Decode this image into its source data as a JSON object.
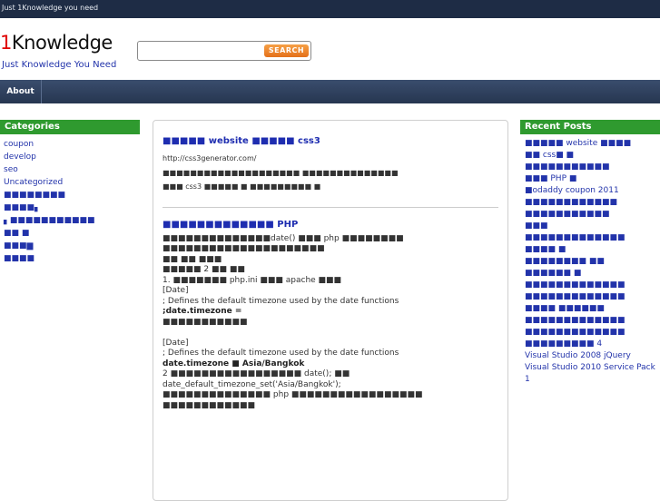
{
  "topbar": {
    "tagline": "Just 1Knowledge you need"
  },
  "header": {
    "logo_prefix": "1",
    "logo_rest": "Knowledge",
    "slogan": "Just Knowledge You Need"
  },
  "search": {
    "placeholder": "",
    "button_label": "SEARCH"
  },
  "nav": {
    "items": [
      {
        "label": "About"
      }
    ]
  },
  "categories": {
    "heading": "Categories",
    "items": [
      {
        "label": "coupon"
      },
      {
        "label": "develop"
      },
      {
        "label": "seo"
      },
      {
        "label": "Uncategorized"
      },
      {
        "label": "■■■■■■■■"
      },
      {
        "label": "■■■■▖"
      },
      {
        "label": "▖■■■■■■■■■■■"
      },
      {
        "label": "■■    ■"
      },
      {
        "label": "■■■▆"
      },
      {
        "label": "■■■■"
      }
    ]
  },
  "recent_posts": {
    "heading": "Recent Posts",
    "items": [
      {
        "label": "■■■■■ website ■■■■"
      },
      {
        "label": "■■ css■    ■"
      },
      {
        "label": "■■■■■■■■■■■"
      },
      {
        "label": "■■■ PHP ■"
      },
      {
        "label": "■odaddy coupon 2011"
      },
      {
        "label": "■■■■■■■■■■■■"
      },
      {
        "label": "■■■■■■■■■■■"
      },
      {
        "label": "■■■"
      },
      {
        "label": "■■■■■■■■■■■■■"
      },
      {
        "label": "■■■■    ■"
      },
      {
        "label": "■■■■■■■■   ■■"
      },
      {
        "label": "■■■■■■    ■"
      },
      {
        "label": "■■■■■■■■■■■■■"
      },
      {
        "label": "■■■■■■■■■■■■■"
      },
      {
        "label": "■■■■    ■■■■■■"
      },
      {
        "label": "■■■■■■■■■■■■■"
      },
      {
        "label": "■■■■■■■■■■■■■"
      },
      {
        "label": "■■■■■■■■■ 4"
      },
      {
        "label": "Visual Studio 2008 jQuery"
      },
      {
        "label": "Visual Studio 2010 Service Pack 1"
      }
    ]
  },
  "posts": [
    {
      "title": "■■■■■ website ■■■■■ css3",
      "url": "http://css3generator.com/",
      "lines": [
        "■■■■■■■■■■■■■■■■■■■■ ■■■■■■■■■■■■■■",
        "■■■ css3 ■■■■■ ■    ■■■■■■■■■ ■"
      ]
    },
    {
      "title": "■■■■■■■■■■■■■ PHP",
      "lines": [
        "■■■■■■■■■■■■■■date() ■■■ php ■■■■■■■■",
        "■■■■■■■■■■■■■■■■■■■■■",
        "■■  ■■    ■■■",
        "■■■■■    2 ■■ ■■",
        "1. ■■■■■■■ php.ini ■■■ apache ■■■",
        "[Date]",
        "; Defines the default timezone used by the date functions",
        ";date.timezone =",
        "■■■■■■■■■■■"
      ],
      "lines2": [
        "[Date]",
        "; Defines the default timezone used by the date functions",
        "date.timezone ■ Asia/Bangkok",
        "2 ■■■■■■■■■■■■■■■■■ date(); ■■",
        "date_default_timezone_set('Asia/Bangkok');",
        "■■■■■■■■■■■■■■ php ■■■■■■■■■■■■■■■■■",
        "■■■■■■■■■■■■"
      ]
    }
  ],
  "colors": {
    "topbar": "#1e2c45",
    "nav": "#2d3e5c",
    "sidebar_head": "#2f9a2f",
    "link": "#2233aa",
    "search_button": "#ec8a2e",
    "logo_accent": "#e00000"
  }
}
